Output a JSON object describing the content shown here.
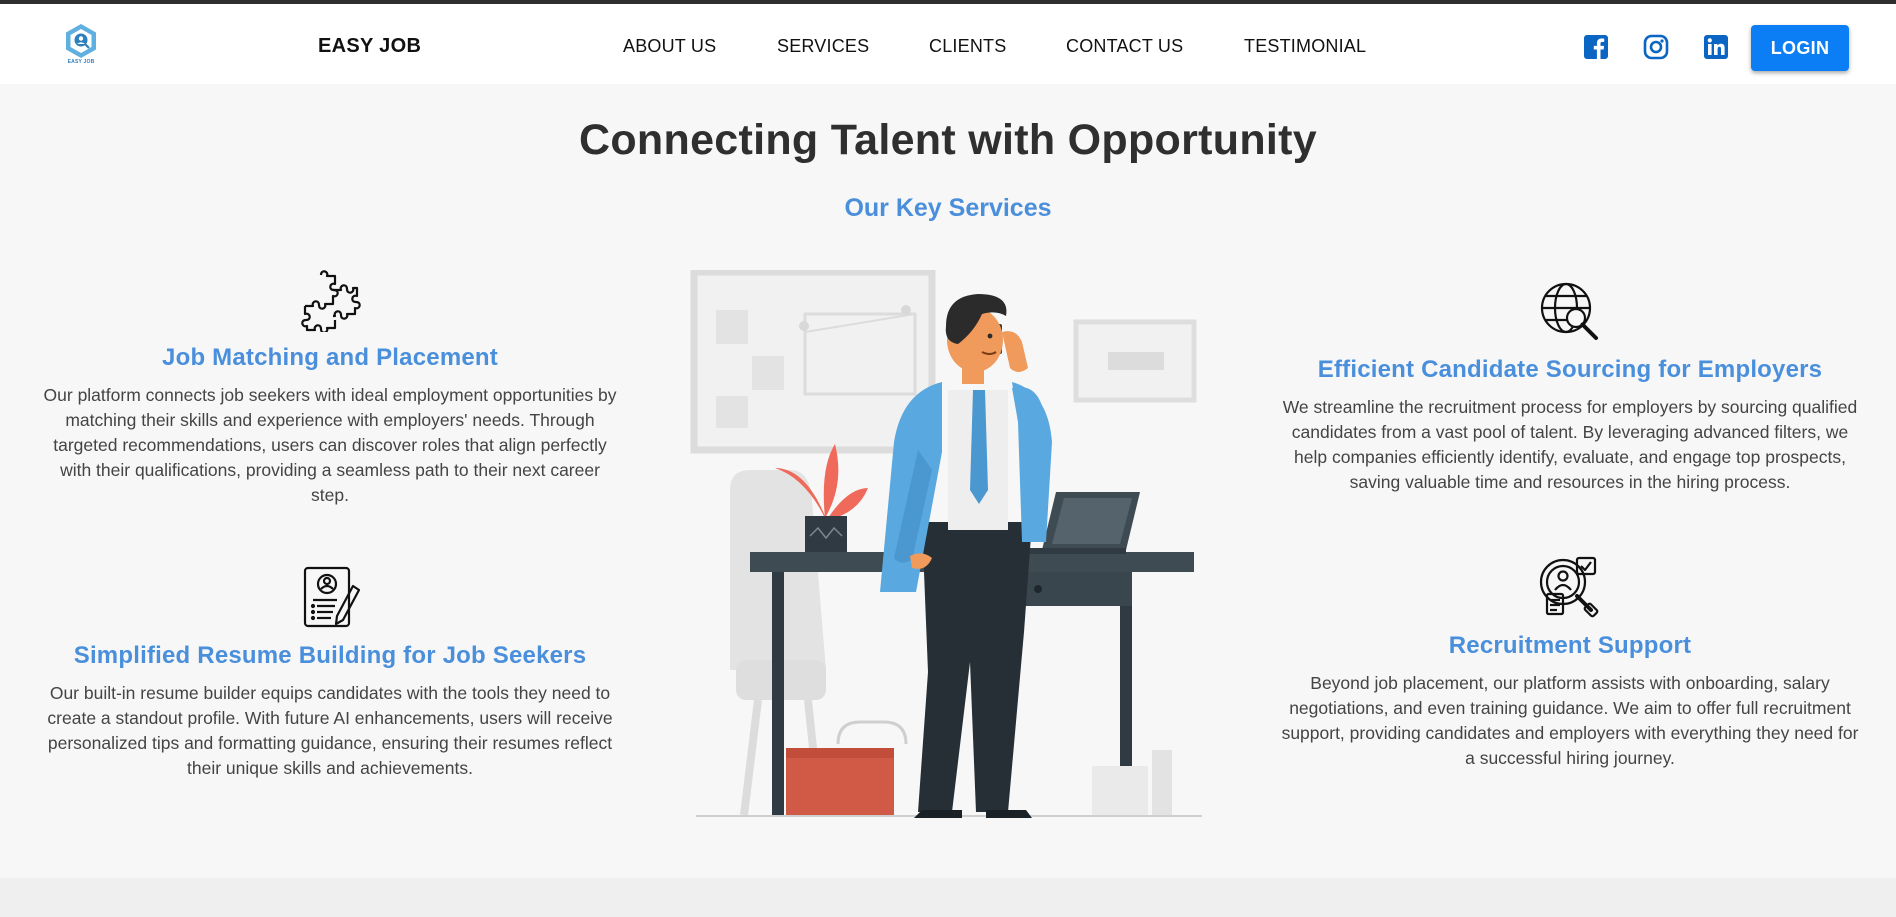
{
  "header": {
    "logo_text": "EASY JOB",
    "brand": "EASY JOB",
    "nav": [
      "ABOUT US",
      "SERVICES",
      "CLIENTS",
      "CONTACT US",
      "TESTIMONIAL"
    ],
    "social_icons": [
      "facebook-icon",
      "instagram-icon",
      "linkedin-icon"
    ],
    "login_label": "LOGIN"
  },
  "main": {
    "title": "Connecting Talent with Opportunity",
    "section_title": "Our Key Services",
    "services": [
      {
        "icon": "puzzle-icon",
        "title": "Job Matching and Placement",
        "text": "Our platform connects job seekers with ideal employment opportunities by matching their skills and experience with employers' needs. Through targeted recommendations, users can discover roles that align perfectly with their qualifications, providing a seamless path to their next career step."
      },
      {
        "icon": "resume-icon",
        "title": "Simplified Resume Building for Job Seekers",
        "text": "Our built-in resume builder equips candidates with the tools they need to create a standout profile. With future AI enhancements, users will receive personalized tips and formatting guidance, ensuring their resumes reflect their unique skills and achievements."
      },
      {
        "icon": "globe-search-icon",
        "title": "Efficient Candidate Sourcing for Employers",
        "text": "We streamline the recruitment process for employers by sourcing qualified candidates from a vast pool of talent. By leveraging advanced filters, we help companies efficiently identify, evaluate, and engage top prospects, saving valuable time and resources in the hiring process."
      },
      {
        "icon": "recruitment-icon",
        "title": "Recruitment Support",
        "text": "Beyond job placement, our platform assists with onboarding, salary negotiations, and even training guidance. We aim to offer full recruitment support, providing candidates and employers with everything they need for a successful hiring journey."
      }
    ]
  },
  "colors": {
    "accent": "#4a8fdc",
    "login": "#0b7ef5",
    "social": "#0a66c2"
  }
}
